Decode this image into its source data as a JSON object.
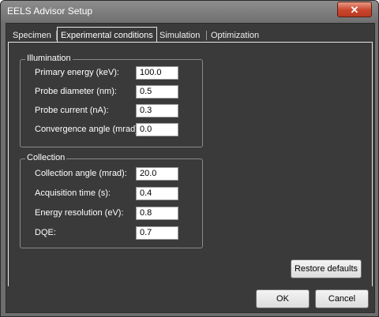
{
  "window": {
    "title": "EELS Advisor Setup",
    "close_label": "✕"
  },
  "tabs": [
    {
      "label": "Specimen",
      "active": false
    },
    {
      "label": "Experimental conditions",
      "active": true
    },
    {
      "label": "Simulation",
      "active": false
    },
    {
      "label": "Optimization",
      "active": false
    }
  ],
  "illumination": {
    "title": "Illumination",
    "rows": [
      {
        "label": "Primary energy (keV):",
        "value": "100.0"
      },
      {
        "label": "Probe diameter (nm):",
        "value": "0.5"
      },
      {
        "label": "Probe current (nA):",
        "value": "0.3"
      },
      {
        "label": "Convergence angle (mrad):",
        "value": "0.0"
      }
    ]
  },
  "collection": {
    "title": "Collection",
    "rows": [
      {
        "label": "Collection angle (mrad):",
        "value": "20.0"
      },
      {
        "label": "Acquisition time (s):",
        "value": "0.4"
      },
      {
        "label": "Energy resolution (eV):",
        "value": "0.8"
      },
      {
        "label": "DQE:",
        "value": "0.7"
      }
    ]
  },
  "buttons": {
    "restore": "Restore defaults",
    "ok": "OK",
    "cancel": "Cancel"
  },
  "colors": {
    "panel_bg": "#3a3a3a",
    "frame_bg": "#6e6e6e",
    "close_red": "#c8452c"
  }
}
